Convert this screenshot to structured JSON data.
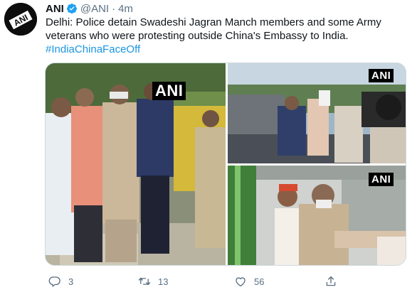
{
  "tweet": {
    "author_name": "ANI",
    "avatar_text": "ANI",
    "handle": "@ANI",
    "separator": "·",
    "time": "4m",
    "text_lines": [
      "Delhi: Police detain Swadeshi Jagran Manch members and some Army",
      "veterans who were protesting outside China's Embassy to India."
    ],
    "hashtag": "#IndiaChinaFaceOff",
    "media": [
      {
        "watermark": "ANI"
      },
      {
        "watermark": "ANI"
      },
      {
        "watermark": "ANI"
      }
    ],
    "actions": {
      "reply_icon": "reply-icon",
      "reply_count": "3",
      "retweet_icon": "retweet-icon",
      "retweet_count": "13",
      "like_icon": "like-icon",
      "like_count": "56",
      "share_icon": "share-icon"
    }
  },
  "colors": {
    "text": "#0f1419",
    "secondary": "#5b7083",
    "link": "#1b95e0",
    "verified": "#1da1f2",
    "border": "#cfd9de"
  }
}
